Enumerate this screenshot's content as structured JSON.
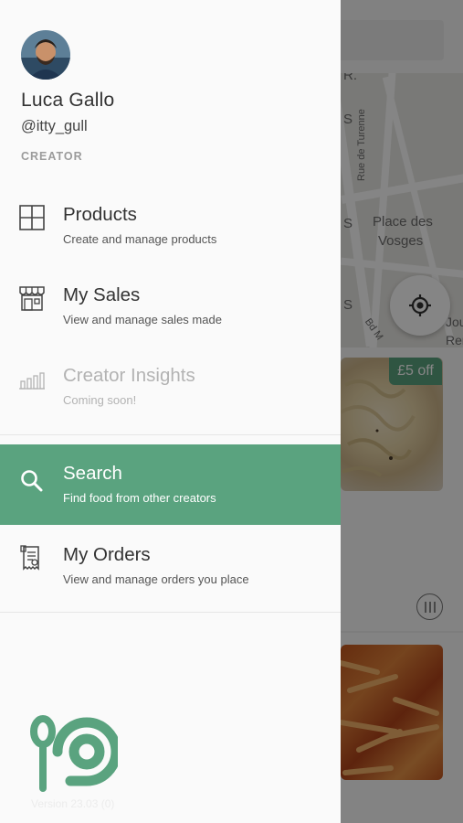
{
  "user": {
    "name": "Luca Gallo",
    "handle": "@itty_gull",
    "role": "CREATOR"
  },
  "menu": [
    {
      "title": "Products",
      "subtitle": "Create and manage products",
      "icon": "grid-icon",
      "state": "normal"
    },
    {
      "title": "My Sales",
      "subtitle": "View and manage sales made",
      "icon": "shop-icon",
      "state": "normal"
    },
    {
      "title": "Creator Insights",
      "subtitle": "Coming soon!",
      "icon": "bar-chart-icon",
      "state": "disabled"
    },
    {
      "title": "Search",
      "subtitle": "Find food from other creators",
      "icon": "search-icon",
      "state": "active"
    },
    {
      "title": "My Orders",
      "subtitle": "View and manage orders you place",
      "icon": "receipt-icon",
      "state": "normal"
    }
  ],
  "version": "Version 23.03 (0)",
  "background": {
    "map_labels": [
      "R.",
      "S",
      "Rue de Turenne",
      "S",
      "Place des",
      "Vosges",
      "S",
      "Bd M",
      "Jou",
      "Rene"
    ],
    "discount": "£5 off"
  },
  "colors": {
    "accent": "#5aa37f",
    "drawer_bg": "#fafafa",
    "text_primary": "#333333",
    "text_muted": "#9b9b9b"
  }
}
